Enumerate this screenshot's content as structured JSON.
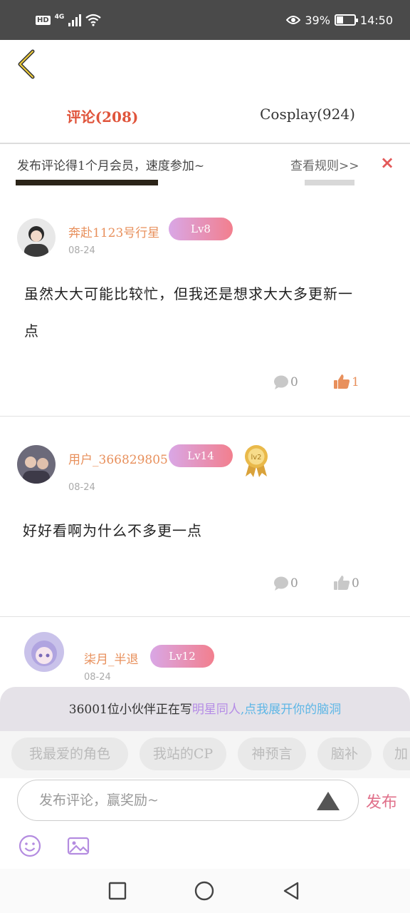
{
  "status_bar": {
    "hd": "HD",
    "network": "4G",
    "battery_percent": "39%",
    "battery_level": 0.39,
    "time": "14:50"
  },
  "tabs": [
    {
      "label": "评论(208)",
      "active": true
    },
    {
      "label": "Cosplay(924)",
      "active": false
    }
  ],
  "notice": {
    "text": "发布评论得1个月会员，速度参加~",
    "rule_link": "查看规则>>",
    "close": "×"
  },
  "comments": [
    {
      "username": "奔赴1123号行星",
      "level": "Lv8",
      "date": "08-24",
      "content_lines": [
        "虽然大大可能比较忙，但我还是想求大大多更新一",
        "点"
      ],
      "reply_count": "0",
      "like_count": "1",
      "liked": true
    },
    {
      "username": "用户_366829805",
      "level": "Lv14",
      "badge": "lv2",
      "date": "08-24",
      "content_lines": [
        "好好看啊为什么不多更一点"
      ],
      "reply_count": "0",
      "like_count": "0",
      "liked": false
    },
    {
      "username": "柒月_半退",
      "level": "Lv12",
      "date": "08-24"
    }
  ],
  "bottom": {
    "prompt": {
      "prefix": "36001位小伙伴正在写",
      "topic": "明星同人",
      "cta": ",点我展开你的脑洞"
    },
    "chips": [
      "我最爱的角色",
      "我站的CP",
      "神预言",
      "脑补",
      "加"
    ],
    "input_placeholder": "发布评论，赢奖励~",
    "publish_label": "发布"
  },
  "colors": {
    "accent": "#e0553c",
    "username": "#e8905c",
    "publish": "#e0708a"
  }
}
